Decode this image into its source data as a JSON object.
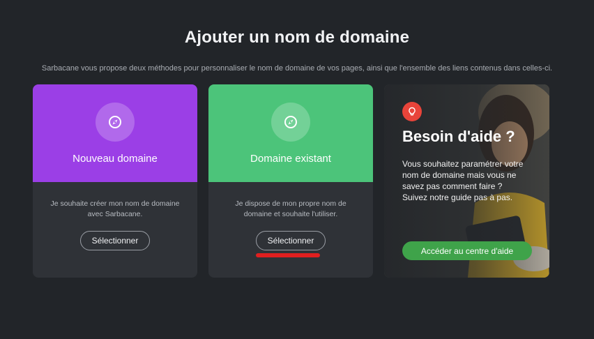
{
  "header": {
    "title": "Ajouter un nom de domaine",
    "subtitle": "Sarbacane vous propose deux méthodes pour personnaliser le nom de domaine de vos pages, ainsi que l'ensemble des liens contenus dans celles-ci."
  },
  "cards": [
    {
      "icon": "compass-icon",
      "title": "Nouveau domaine",
      "description": "Je souhaite créer mon nom de domaine avec Sarbacane.",
      "button_label": "Sélectionner",
      "color": "#9b3fe6"
    },
    {
      "icon": "compass-icon",
      "title": "Domaine existant",
      "description": "Je dispose de mon propre nom de domaine et souhaite l'utiliser.",
      "button_label": "Sélectionner",
      "color": "#4cc47a"
    }
  ],
  "help": {
    "icon": "lightbulb-icon",
    "title": "Besoin d'aide ?",
    "text": "Vous souhaitez paramétrer votre nom de domaine mais vous ne savez pas comment faire ? Suivez notre guide pas à pas.",
    "button_label": "Accéder au centre d'aide",
    "button_color": "#3fa34a",
    "badge_color": "#e8443a"
  },
  "colors": {
    "background": "#222529",
    "card_background": "#2f3237",
    "highlight": "#e01f1f"
  }
}
